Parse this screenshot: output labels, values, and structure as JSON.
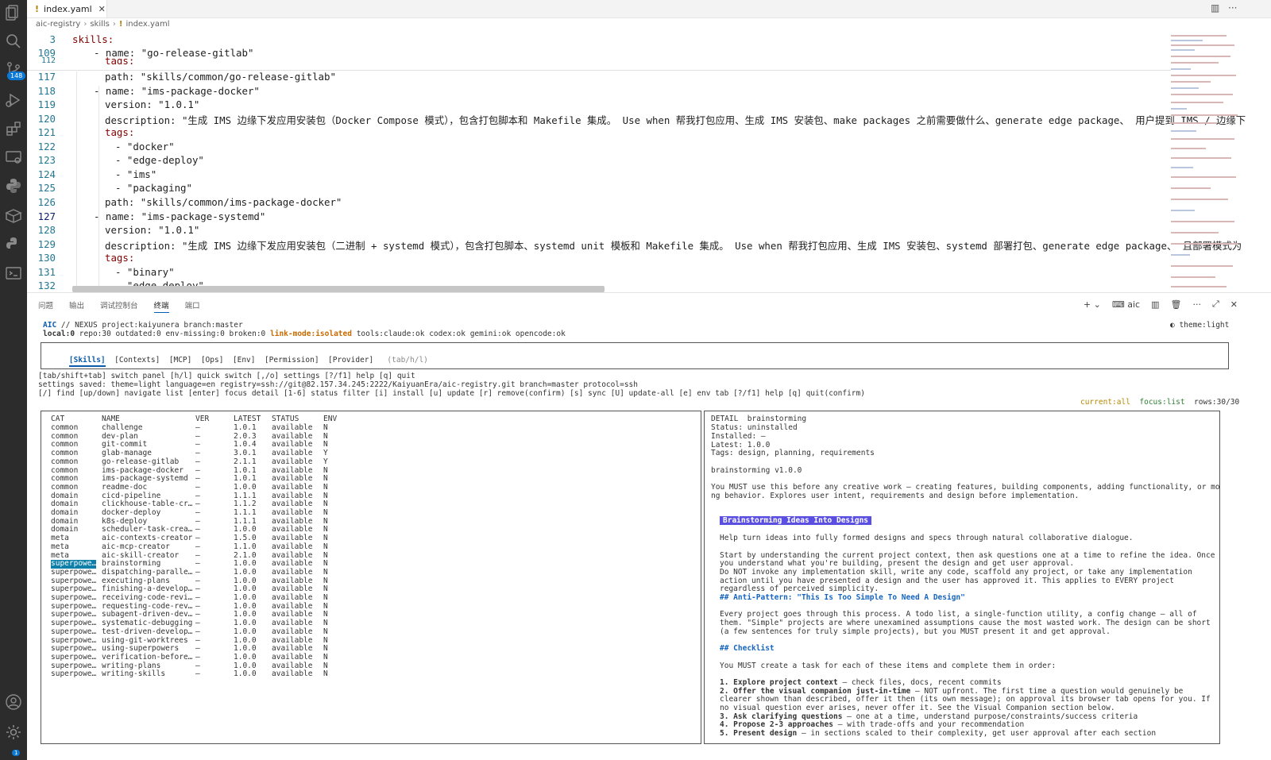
{
  "tab": {
    "title": "index.yaml"
  },
  "breadcrumb": [
    "aic-registry",
    "skills",
    "index.yaml"
  ],
  "activity": {
    "source_control_badge": "148",
    "settings_badge": "1"
  },
  "editor": {
    "lines": [
      {
        "num": "3",
        "text": "skills:"
      },
      {
        "num": "109",
        "text": "- name: \"go-release-gitlab\""
      },
      {
        "num": "112",
        "text": "tags:"
      },
      {
        "num": "117",
        "text": "path: \"skills/common/go-release-gitlab\""
      },
      {
        "num": "118",
        "text": "- name: \"ims-package-docker\""
      },
      {
        "num": "119",
        "text": "version: \"1.0.1\""
      },
      {
        "num": "120",
        "text": "description: \"生成 IMS 边缘下发应用安装包（Docker Compose 模式），包含打包脚本和 Makefile 集成。 Use when 帮我打包应用、生成 IMS 安装包、make packages 之前需要做什么、generate edge package、 用户提到 IMS / 边缘下"
      },
      {
        "num": "121",
        "text": "tags:"
      },
      {
        "num": "122",
        "text": "- \"docker\""
      },
      {
        "num": "123",
        "text": "- \"edge-deploy\""
      },
      {
        "num": "124",
        "text": "- \"ims\""
      },
      {
        "num": "125",
        "text": "- \"packaging\""
      },
      {
        "num": "126",
        "text": "path: \"skills/common/ims-package-docker\""
      },
      {
        "num": "127",
        "text": "- name: \"ims-package-systemd\""
      },
      {
        "num": "128",
        "text": "version: \"1.0.1\""
      },
      {
        "num": "129",
        "text": "description: \"生成 IMS 边缘下发应用安装包（二进制 + systemd 模式），包含打包脚本、systemd unit 模板和 Makefile 集成。 Use when 帮我打包应用、生成 IMS 安装包、systemd 部署打包、generate edge package、 且部署模式为"
      },
      {
        "num": "130",
        "text": "tags:"
      },
      {
        "num": "131",
        "text": "- \"binary\""
      },
      {
        "num": "132",
        "text": "- \"edge-deploy\""
      }
    ]
  },
  "panel": {
    "tabs": [
      "问题",
      "输出",
      "调试控制台",
      "终端",
      "端口"
    ],
    "active_tab": "终端",
    "terminal_name": "aic"
  },
  "terminal": {
    "header_brand": "AIC",
    "header_rest": "// NEXUS project:kaiyunera branch:master",
    "theme": "◐ theme:light",
    "status_a": "local:0",
    "status_b": "repo:30 outdated:0 env-missing:0 broken:0",
    "status_link": "link-mode:isolated",
    "status_tools": "tools:claude:ok codex:ok gemini:ok opencode:ok",
    "tabs": [
      "[Skills]",
      "[Contexts]",
      "[MCP]",
      "[Ops]",
      "[Env]",
      "[Permission]",
      "[Provider]"
    ],
    "tabs_hint": "(tab/h/l)",
    "help1": "[tab/shift+tab] switch panel [h/l] quick switch [,/o] settings [?/f1] help [q] quit",
    "help2": "settings saved: theme=light language=en registry=ssh://git@82.157.34.245:2222/KaiyuanEra/aic-registry.git branch=master protocol=ssh",
    "help3": "[/] find [up/down] navigate list [enter] focus detail [1-6] status filter [i] install [u] update [r] remove(confirm) [s] sync [U] update-all [e] env tab [?/f1] help [q] quit(confirm)",
    "current": "current:all",
    "focus": "focus:list",
    "rows": "rows:30/30",
    "columns": [
      "CAT",
      "NAME",
      "VER",
      "LATEST",
      "STATUS",
      "ENV"
    ],
    "skills": [
      [
        "common",
        "challenge",
        "–",
        "1.0.1",
        "available",
        "N"
      ],
      [
        "common",
        "dev-plan",
        "–",
        "2.0.3",
        "available",
        "N"
      ],
      [
        "common",
        "git-commit",
        "–",
        "1.0.4",
        "available",
        "N"
      ],
      [
        "common",
        "glab-manage",
        "–",
        "3.0.1",
        "available",
        "Y"
      ],
      [
        "common",
        "go-release-gitlab",
        "–",
        "2.1.1",
        "available",
        "Y"
      ],
      [
        "common",
        "ims-package-docker",
        "–",
        "1.0.1",
        "available",
        "N"
      ],
      [
        "common",
        "ims-package-systemd",
        "–",
        "1.0.1",
        "available",
        "N"
      ],
      [
        "common",
        "readme-doc",
        "–",
        "1.0.0",
        "available",
        "N"
      ],
      [
        "domain",
        "cicd-pipeline",
        "–",
        "1.1.1",
        "available",
        "N"
      ],
      [
        "domain",
        "clickhouse-table-cr…",
        "–",
        "1.1.2",
        "available",
        "N"
      ],
      [
        "domain",
        "docker-deploy",
        "–",
        "1.1.1",
        "available",
        "N"
      ],
      [
        "domain",
        "k8s-deploy",
        "–",
        "1.1.1",
        "available",
        "N"
      ],
      [
        "domain",
        "scheduler-task-crea…",
        "–",
        "1.0.0",
        "available",
        "N"
      ],
      [
        "meta",
        "aic-contexts-creator",
        "–",
        "1.5.0",
        "available",
        "N"
      ],
      [
        "meta",
        "aic-mcp-creator",
        "–",
        "1.1.0",
        "available",
        "N"
      ],
      [
        "meta",
        "aic-skill-creator",
        "–",
        "2.1.0",
        "available",
        "N"
      ],
      [
        "superpowe…",
        "brainstorming",
        "–",
        "1.0.0",
        "available",
        "N"
      ],
      [
        "superpowe…",
        "dispatching-paralle…",
        "–",
        "1.0.0",
        "available",
        "N"
      ],
      [
        "superpowe…",
        "executing-plans",
        "–",
        "1.0.0",
        "available",
        "N"
      ],
      [
        "superpowe…",
        "finishing-a-develop…",
        "–",
        "1.0.0",
        "available",
        "N"
      ],
      [
        "superpowe…",
        "receiving-code-revi…",
        "–",
        "1.0.0",
        "available",
        "N"
      ],
      [
        "superpowe…",
        "requesting-code-rev…",
        "–",
        "1.0.0",
        "available",
        "N"
      ],
      [
        "superpowe…",
        "subagent-driven-dev…",
        "–",
        "1.0.0",
        "available",
        "N"
      ],
      [
        "superpowe…",
        "systematic-debugging",
        "–",
        "1.0.0",
        "available",
        "N"
      ],
      [
        "superpowe…",
        "test-driven-develop…",
        "–",
        "1.0.0",
        "available",
        "N"
      ],
      [
        "superpowe…",
        "using-git-worktrees",
        "–",
        "1.0.0",
        "available",
        "N"
      ],
      [
        "superpowe…",
        "using-superpowers",
        "–",
        "1.0.0",
        "available",
        "N"
      ],
      [
        "superpowe…",
        "verification-before…",
        "–",
        "1.0.0",
        "available",
        "N"
      ],
      [
        "superpowe…",
        "writing-plans",
        "–",
        "1.0.0",
        "available",
        "N"
      ],
      [
        "superpowe…",
        "writing-skills",
        "–",
        "1.0.0",
        "available",
        "N"
      ]
    ],
    "selected_index": 16,
    "detail": {
      "title": "DETAIL  brainstorming",
      "status": "Status: uninstalled",
      "installed": "Installed: –",
      "latest": "Latest: 1.0.0",
      "tags": "Tags: design, planning, requirements",
      "version_line": "brainstorming v1.0.0",
      "desc1": "You MUST use this before any creative work – creating features, building components, adding functionality, or modifyi",
      "desc2": "ng behavior. Explores user intent, requirements and design before implementation.",
      "heading": "Brainstorming Ideas Into Designs",
      "p1": "Help turn ideas into fully formed designs and specs through natural collaborative dialogue.",
      "p2_1": "Start by understanding the current project context, then ask questions one at a time to refine the idea. Once",
      "p2_2": "you understand what you're building, present the design and get user approval.",
      "p3_1": "Do NOT invoke any implementation skill, write any code, scaffold any project, or take any implementation",
      "p3_2": "action until you have presented a design and the user has approved it. This applies to EVERY project",
      "p3_3": "regardless of perceived simplicity.",
      "anti": "## Anti-Pattern: \"This Is Too Simple To Need A Design\"",
      "p4_1": "Every project goes through this process. A todo list, a single-function utility, a config change – all of",
      "p4_2": "them. \"Simple\" projects are where unexamined assumptions cause the most wasted work. The design can be short",
      "p4_3": "(a few sentences for truly simple projects), but you MUST present it and get approval.",
      "checklist": "## Checklist",
      "p5": "You MUST create a task for each of these items and complete them in order:",
      "i1b": "1. Explore project context",
      "i1": " – check files, docs, recent commits",
      "i2b": "2. Offer the visual companion just-in-time",
      "i2": " – NOT upfront. The first time a question would genuinely be",
      "i2_2": "clearer shown than described, offer it then (its own message); on approval its browser tab opens for you. If",
      "i2_3": "no visual question ever arises, never offer it. See the Visual Companion section below.",
      "i3b": "3. Ask clarifying questions",
      "i3": " – one at a time, understand purpose/constraints/success criteria",
      "i4b": "4. Propose 2-3 approaches",
      "i4": " – with trade-offs and your recommendation",
      "i5b": "5. Present design",
      "i5": " – in sections scaled to their complexity, get user approval after each section"
    }
  }
}
